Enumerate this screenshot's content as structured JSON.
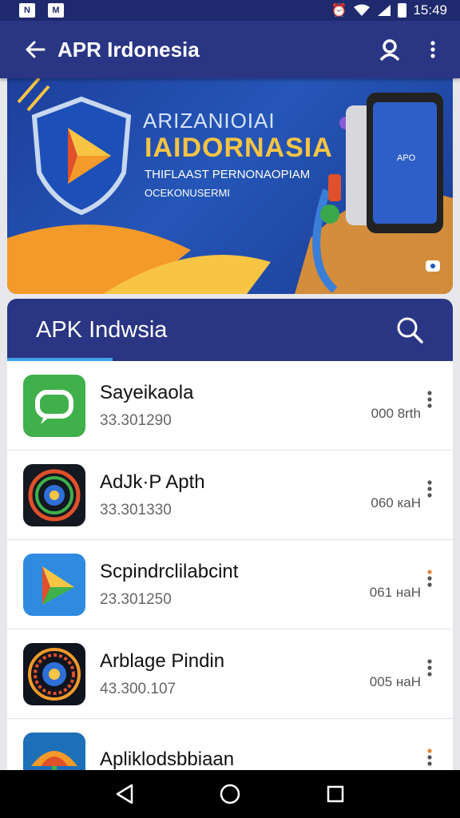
{
  "status_bar": {
    "left_icons": [
      "N",
      "M"
    ],
    "time": "15:49"
  },
  "app_bar": {
    "title": "APR Irdonesia"
  },
  "banner": {
    "title_line1": "ARIZANIOIAI",
    "title_line2": "IAIDORNASIA",
    "subtitle_line1": "THIFLAAST PERNONAOPIAM",
    "subtitle_line2": "OCEKONUSERMI",
    "phone_label": "APO"
  },
  "list": {
    "title": "APK Indwsia",
    "items": [
      {
        "name": "Sayeikaola",
        "version": "33.301290",
        "size": "000 8rth",
        "icon": "chat-app-icon"
      },
      {
        "name": "AdJk·P Apth",
        "version": "33.301330",
        "size": "060 каH",
        "icon": "dial-app-icon"
      },
      {
        "name": "Scpindrclilabcint",
        "version": "23.301250",
        "size": "061 наH",
        "icon": "arrow-app-icon"
      },
      {
        "name": "Arblage Pindin",
        "version": "43.300.107",
        "size": "005 наH",
        "icon": "ring-app-icon"
      },
      {
        "name": "Apliklodsbbiaan",
        "version": "",
        "size": "",
        "icon": "umbrella-app-icon"
      }
    ]
  },
  "colors": {
    "primary": "#2a3584",
    "status_bar": "#1f2a6e",
    "accent": "#40a0e8"
  }
}
